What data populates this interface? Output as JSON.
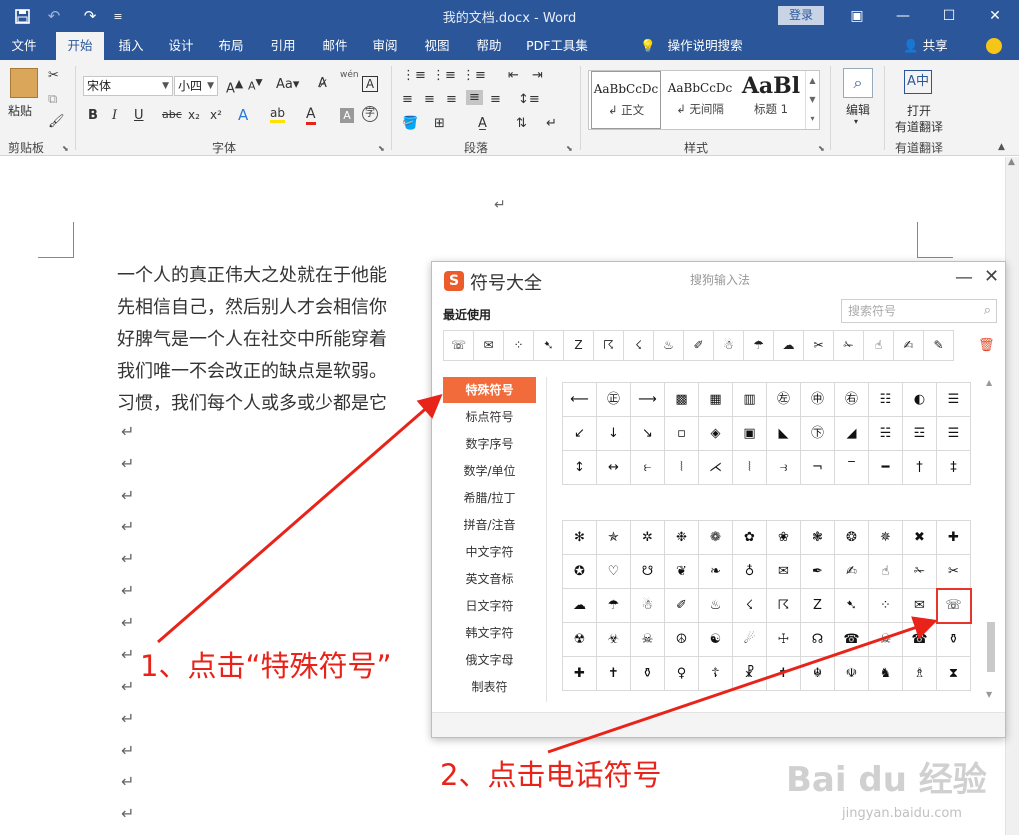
{
  "titlebar": {
    "doc_title": "我的文档.docx  -  Word",
    "login": "登录",
    "quick_access": [
      "save-icon",
      "undo-icon",
      "redo-icon",
      "customize-icon"
    ]
  },
  "tabs": [
    {
      "label": "文件",
      "active": false
    },
    {
      "label": "开始",
      "active": true
    },
    {
      "label": "插入",
      "active": false
    },
    {
      "label": "设计",
      "active": false
    },
    {
      "label": "布局",
      "active": false
    },
    {
      "label": "引用",
      "active": false
    },
    {
      "label": "邮件",
      "active": false
    },
    {
      "label": "审阅",
      "active": false
    },
    {
      "label": "视图",
      "active": false
    },
    {
      "label": "帮助",
      "active": false
    },
    {
      "label": "PDF工具集",
      "active": false
    }
  ],
  "tell_me": "操作说明搜索",
  "share": "共享",
  "ribbon": {
    "clipboard": {
      "paste": "粘贴",
      "label": "剪贴板"
    },
    "font": {
      "family": "宋体",
      "size": "小四",
      "label": "字体",
      "aa": "Aa",
      "wen": "wén"
    },
    "paragraph": {
      "label": "段落"
    },
    "styles": {
      "label": "样式",
      "items": [
        {
          "preview": "AaBbCcDc",
          "name": "↲ 正文"
        },
        {
          "preview": "AaBbCcDc",
          "name": "↲ 无间隔"
        },
        {
          "preview": "AaBl",
          "name": "标题 1"
        }
      ]
    },
    "editing": {
      "label": "编辑"
    },
    "youdao": {
      "btn_line1": "打开",
      "btn_line2": "有道翻译",
      "label": "有道翻译"
    }
  },
  "document": {
    "lines": [
      "一个人的真正伟大之处就在于他能",
      "先相信自己，然后别人才会相信你",
      "好脾气是一个人在社交中所能穿着",
      "我们唯一不会改正的缺点是软弱。",
      "习惯，我们每个人或多或少都是它"
    ],
    "return_mark": "↵"
  },
  "dialog": {
    "logo": "S",
    "title": "符号大全",
    "subtitle": "搜狗输入法",
    "recent_label": "最近使用",
    "search_placeholder": "搜索符号",
    "recent": [
      "☏",
      "✉",
      "⁘",
      "➷",
      "Z",
      "☈",
      "☇",
      "♨",
      "✐",
      "☃",
      "☂",
      "☁",
      "✂",
      "✁",
      "☝",
      "✍",
      "✎"
    ],
    "categories": [
      {
        "label": "特殊符号",
        "active": true
      },
      {
        "label": "标点符号",
        "active": false
      },
      {
        "label": "数字序号",
        "active": false
      },
      {
        "label": "数学/单位",
        "active": false
      },
      {
        "label": "希腊/拉丁",
        "active": false
      },
      {
        "label": "拼音/注音",
        "active": false
      },
      {
        "label": "中文字符",
        "active": false
      },
      {
        "label": "英文音标",
        "active": false
      },
      {
        "label": "日文字符",
        "active": false
      },
      {
        "label": "韩文字符",
        "active": false
      },
      {
        "label": "俄文字母",
        "active": false
      },
      {
        "label": "制表符",
        "active": false
      }
    ],
    "grid_top": [
      "⟵",
      "㊣",
      "⟶",
      "▩",
      "▦",
      "▥",
      "㊧",
      "㊥",
      "㊨",
      "☷",
      "◐",
      "☰",
      "↙",
      "↓",
      "↘",
      "▫",
      "◈",
      "▣",
      "◣",
      "㊦",
      "◢",
      "☵",
      "☲",
      "☰",
      "↕",
      "↔",
      "⥼",
      "⦚",
      "⋌",
      "⦚",
      "⥽",
      "¬",
      "‾",
      "━",
      "†",
      "‡"
    ],
    "grid_bottom": [
      "✻",
      "✯",
      "✲",
      "❉",
      "❁",
      "✿",
      "❀",
      "❃",
      "❂",
      "✵",
      "✖",
      "✚",
      "✪",
      "♡",
      "☋",
      "❦",
      "❧",
      "♁",
      "✉",
      "✒",
      "✍",
      "☝",
      "✁",
      "✂",
      "☁",
      "☂",
      "☃",
      "✐",
      "♨",
      "☇",
      "☈",
      "Z",
      "➷",
      "⁘",
      "✉",
      "☏",
      "☢",
      "☣",
      "☠",
      "☮",
      "☯",
      "☄",
      "☩",
      "☊",
      "☎",
      "☠",
      "☎",
      "⚱",
      "✚",
      "✝",
      "⚱",
      "♀",
      "☦",
      "☧",
      "✝",
      "☬",
      "☫",
      "♞",
      "♗",
      "⧗"
    ],
    "selected_symbol": "☏"
  },
  "annotations": {
    "step1": "1、点击“特殊符号”",
    "step2": "2、点击电话符号"
  },
  "watermark": {
    "text": "Bai du 经验",
    "url": "jingyan.baidu.com"
  }
}
